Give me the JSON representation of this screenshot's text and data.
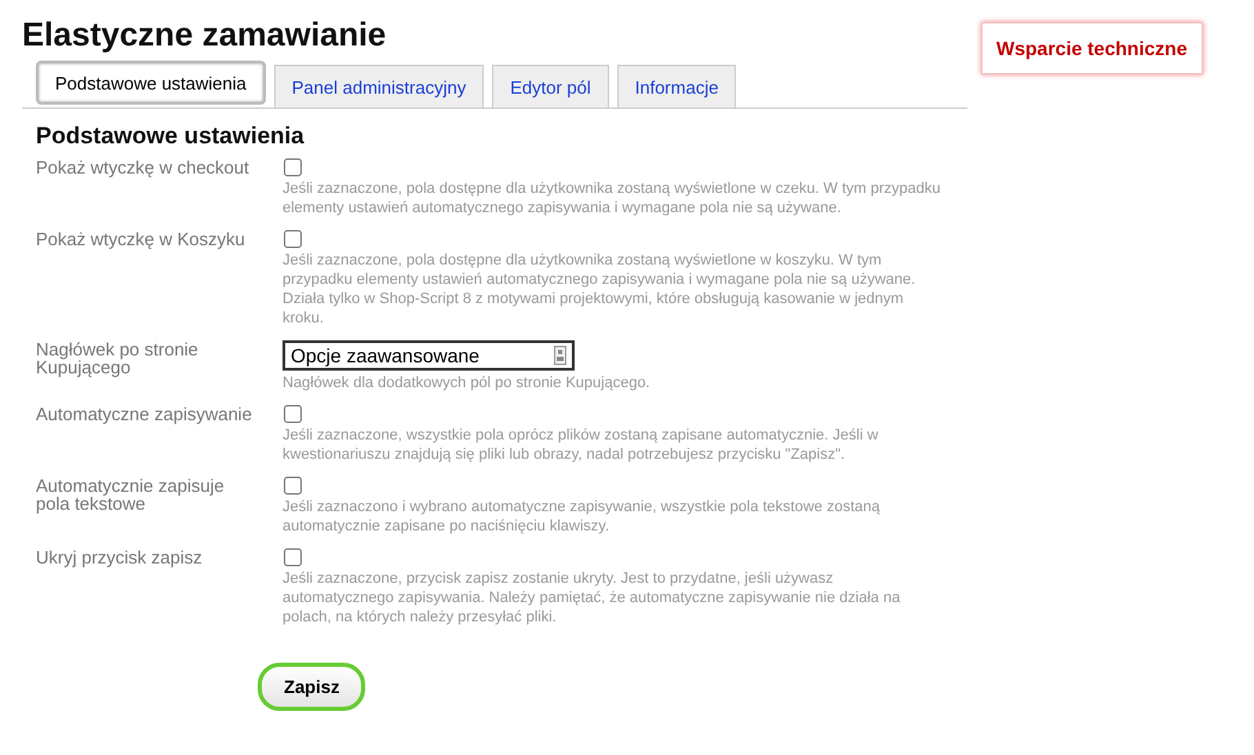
{
  "page": {
    "title": "Elastyczne zamawianie",
    "support_button": "Wsparcie techniczne"
  },
  "tabs": [
    {
      "label": "Podstawowe ustawienia",
      "selected": true
    },
    {
      "label": "Panel administracyjny",
      "selected": false
    },
    {
      "label": "Edytor pól",
      "selected": false
    },
    {
      "label": "Informacje",
      "selected": false
    }
  ],
  "section_title": "Podstawowe ustawienia",
  "settings": [
    {
      "kind": "checkbox",
      "label": "Pokaż wtyczkę w checkout",
      "checked": false,
      "description": "Jeśli zaznaczone, pola dostępne dla użytkownika zostaną wyświetlone w czeku. W tym przypadku elementy ustawień automatycznego zapisywania i wymagane pola nie są używane."
    },
    {
      "kind": "checkbox",
      "label": "Pokaż wtyczkę w Koszyku",
      "checked": false,
      "description": "Jeśli zaznaczone, pola dostępne dla użytkownika zostaną wyświetlone w koszyku. W tym przypadku elementy ustawień automatycznego zapisywania i wymagane pola nie są używane. Działa tylko w Shop-Script 8 z motywami projektowymi, które obsługują kasowanie w jednym kroku."
    },
    {
      "kind": "text",
      "label": "Nagłówek po stronie Kupującego",
      "value": "Opcje zaawansowane",
      "description": "Nagłówek dla dodatkowych pól po stronie Kupującego."
    },
    {
      "kind": "checkbox",
      "label": "Automatyczne zapisywanie",
      "checked": false,
      "description": "Jeśli zaznaczone, wszystkie pola oprócz plików zostaną zapisane automatycznie. Jeśli w kwestionariuszu znajdują się pliki lub obrazy, nadal potrzebujesz przycisku \"Zapisz\"."
    },
    {
      "kind": "checkbox",
      "label": "Automatycznie zapisuje pola tekstowe",
      "checked": false,
      "description": "Jeśli zaznaczono i wybrano automatyczne zapisywanie, wszystkie pola tekstowe zostaną automatycznie zapisane po naciśnięciu klawiszy."
    },
    {
      "kind": "checkbox",
      "label": "Ukryj przycisk zapisz",
      "checked": false,
      "description": "Jeśli zaznaczone, przycisk zapisz zostanie ukryty. Jest to przydatne, jeśli używasz automatycznego zapisywania. Należy pamiętać, że automatyczne zapisywanie nie działa na polach, na których należy przesyłać pliki."
    }
  ],
  "save_button": "Zapisz"
}
